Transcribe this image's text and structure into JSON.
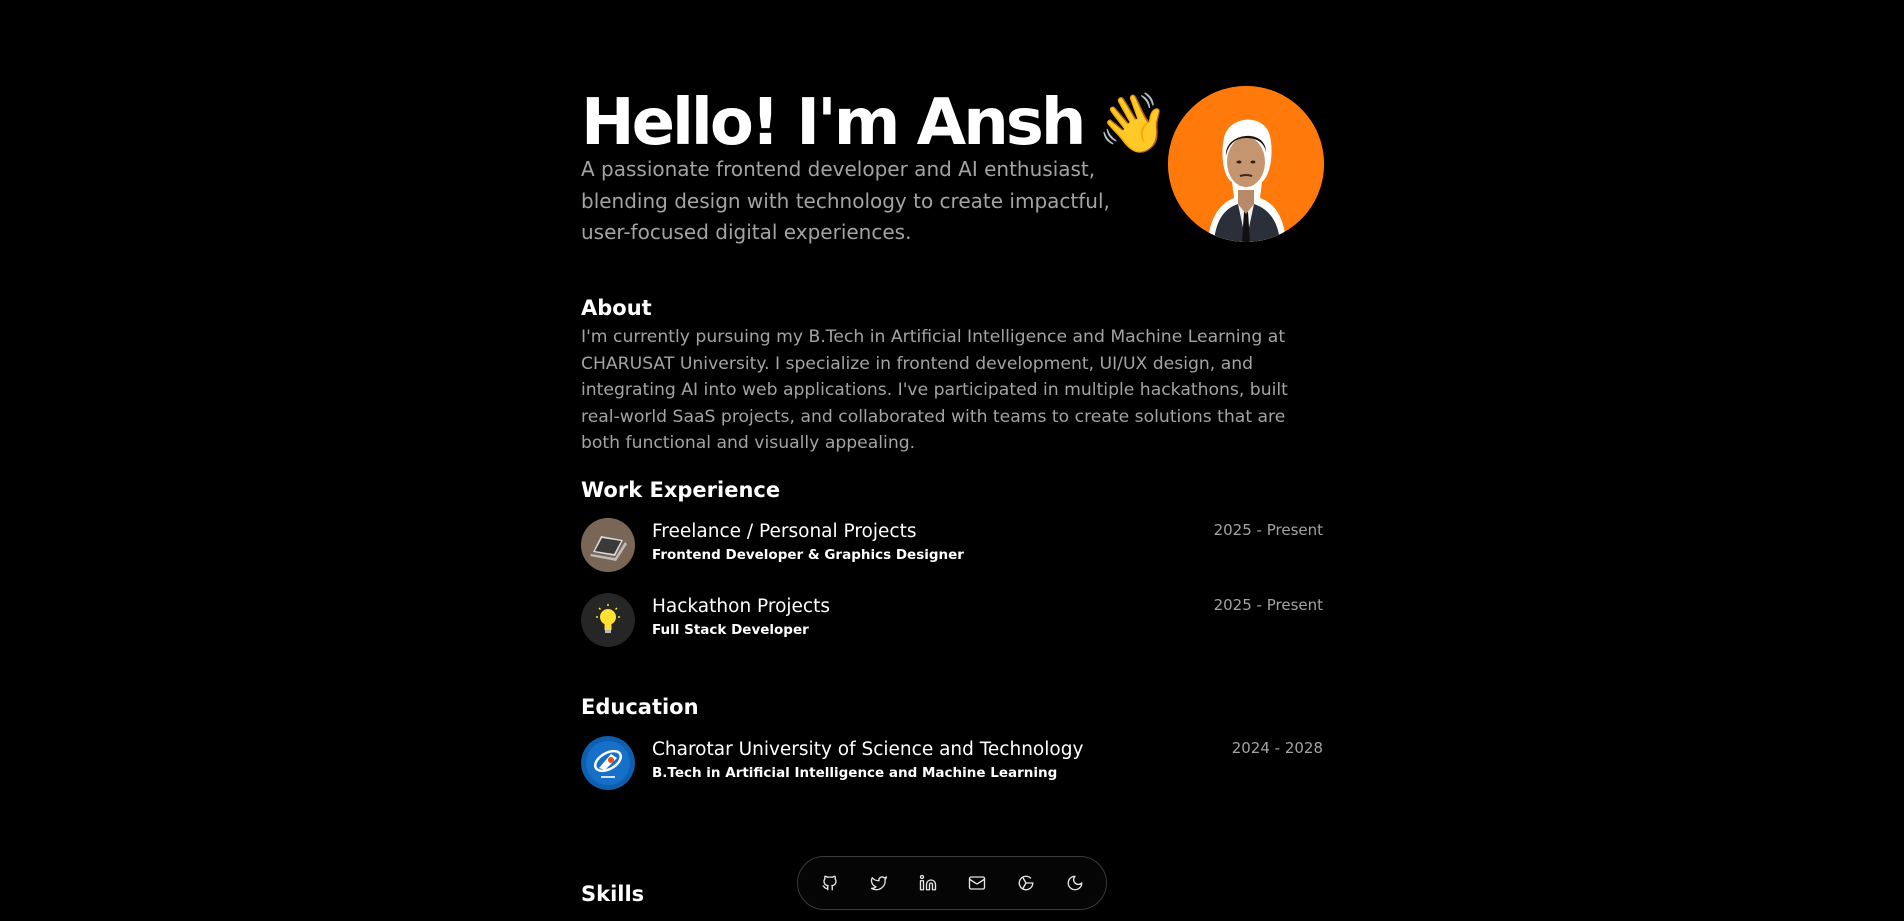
{
  "hero": {
    "title": "Hello! I'm Ansh",
    "wave_emoji": "👋",
    "subtitle": "A passionate frontend developer and AI enthusiast, blending design with technology to create impactful, user-focused digital experiences.",
    "avatar_background": "#ff7a0a"
  },
  "about": {
    "heading": "About",
    "text": "I'm currently pursuing my B.Tech in Artificial Intelligence and Machine Learning at CHARUSAT University. I specialize in frontend development, UI/UX design, and integrating AI into web applications. I've participated in multiple hackathons, built real-world SaaS projects, and collaborated with teams to create solutions that are both functional and visually appealing."
  },
  "work": {
    "heading": "Work Experience",
    "items": [
      {
        "title": "Freelance / Personal Projects",
        "role": "Frontend Developer & Graphics Designer",
        "period": "2025 - Present",
        "icon": "laptop-icon"
      },
      {
        "title": "Hackathon Projects",
        "role": "Full Stack Developer",
        "period": "2025 - Present",
        "icon": "lightbulb-icon"
      }
    ]
  },
  "education": {
    "heading": "Education",
    "items": [
      {
        "title": "Charotar University of Science and Technology",
        "degree": "B.Tech in Artificial Intelligence and Machine Learning",
        "period": "2024 - 2028",
        "icon": "university-logo"
      }
    ]
  },
  "skills": {
    "heading": "Skills"
  },
  "dock": {
    "items": [
      {
        "icon": "github-icon"
      },
      {
        "icon": "twitter-icon"
      },
      {
        "icon": "linkedin-icon"
      },
      {
        "icon": "mail-icon"
      },
      {
        "icon": "chrome-icon"
      },
      {
        "icon": "moon-icon"
      }
    ]
  },
  "colors": {
    "background": "#000000",
    "text": "#ffffff",
    "muted": "#a3a3a3",
    "accent": "#ff7a0a"
  }
}
